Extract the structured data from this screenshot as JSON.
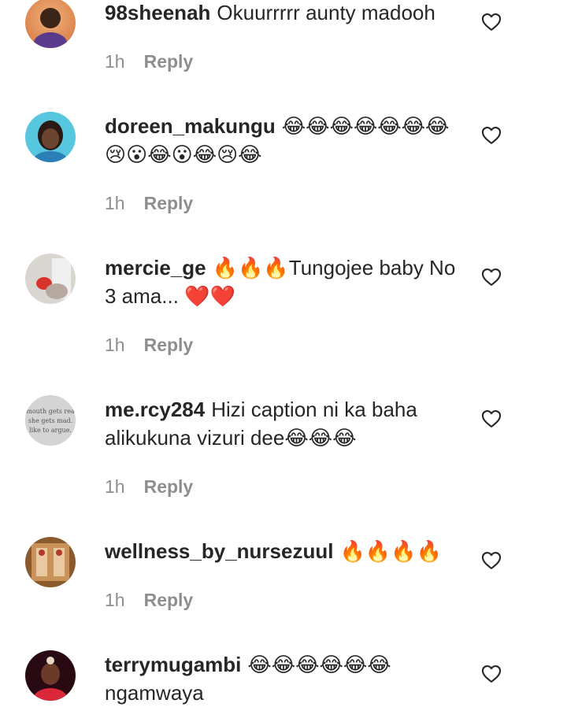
{
  "comments": [
    {
      "username": "98sheenah",
      "text": "Okuurrrrr aunty madooh",
      "time": "1h",
      "reply_label": "Reply"
    },
    {
      "username": "doreen_makungu",
      "text": "😂😂😂😂😂😂😂😢😮😂😮😂😢😂",
      "time": "1h",
      "reply_label": "Reply"
    },
    {
      "username": "mercie_ge",
      "text": "🔥🔥🔥Tungojee baby No 3 ama... ❤️❤️",
      "time": "1h",
      "reply_label": "Reply"
    },
    {
      "username": "me.rcy284",
      "text": "Hizi caption ni ka baha alikukuna vizuri dee😂😂😂",
      "time": "1h",
      "reply_label": "Reply",
      "avatar_text": [
        "mouth gets rea",
        "she gets mad.",
        "like to argue."
      ]
    },
    {
      "username": "wellness_by_nursezuul",
      "text": "🔥🔥🔥🔥",
      "time": "1h",
      "reply_label": "Reply"
    },
    {
      "username": "terrymugambi",
      "text": "😂😂😂😂😂😂 ngamwaya",
      "time": "",
      "reply_label": ""
    }
  ],
  "icons": {
    "like": "heart-outline-icon"
  },
  "colors": {
    "text_primary": "#262626",
    "text_secondary": "#8e8e8e",
    "background": "#ffffff"
  }
}
